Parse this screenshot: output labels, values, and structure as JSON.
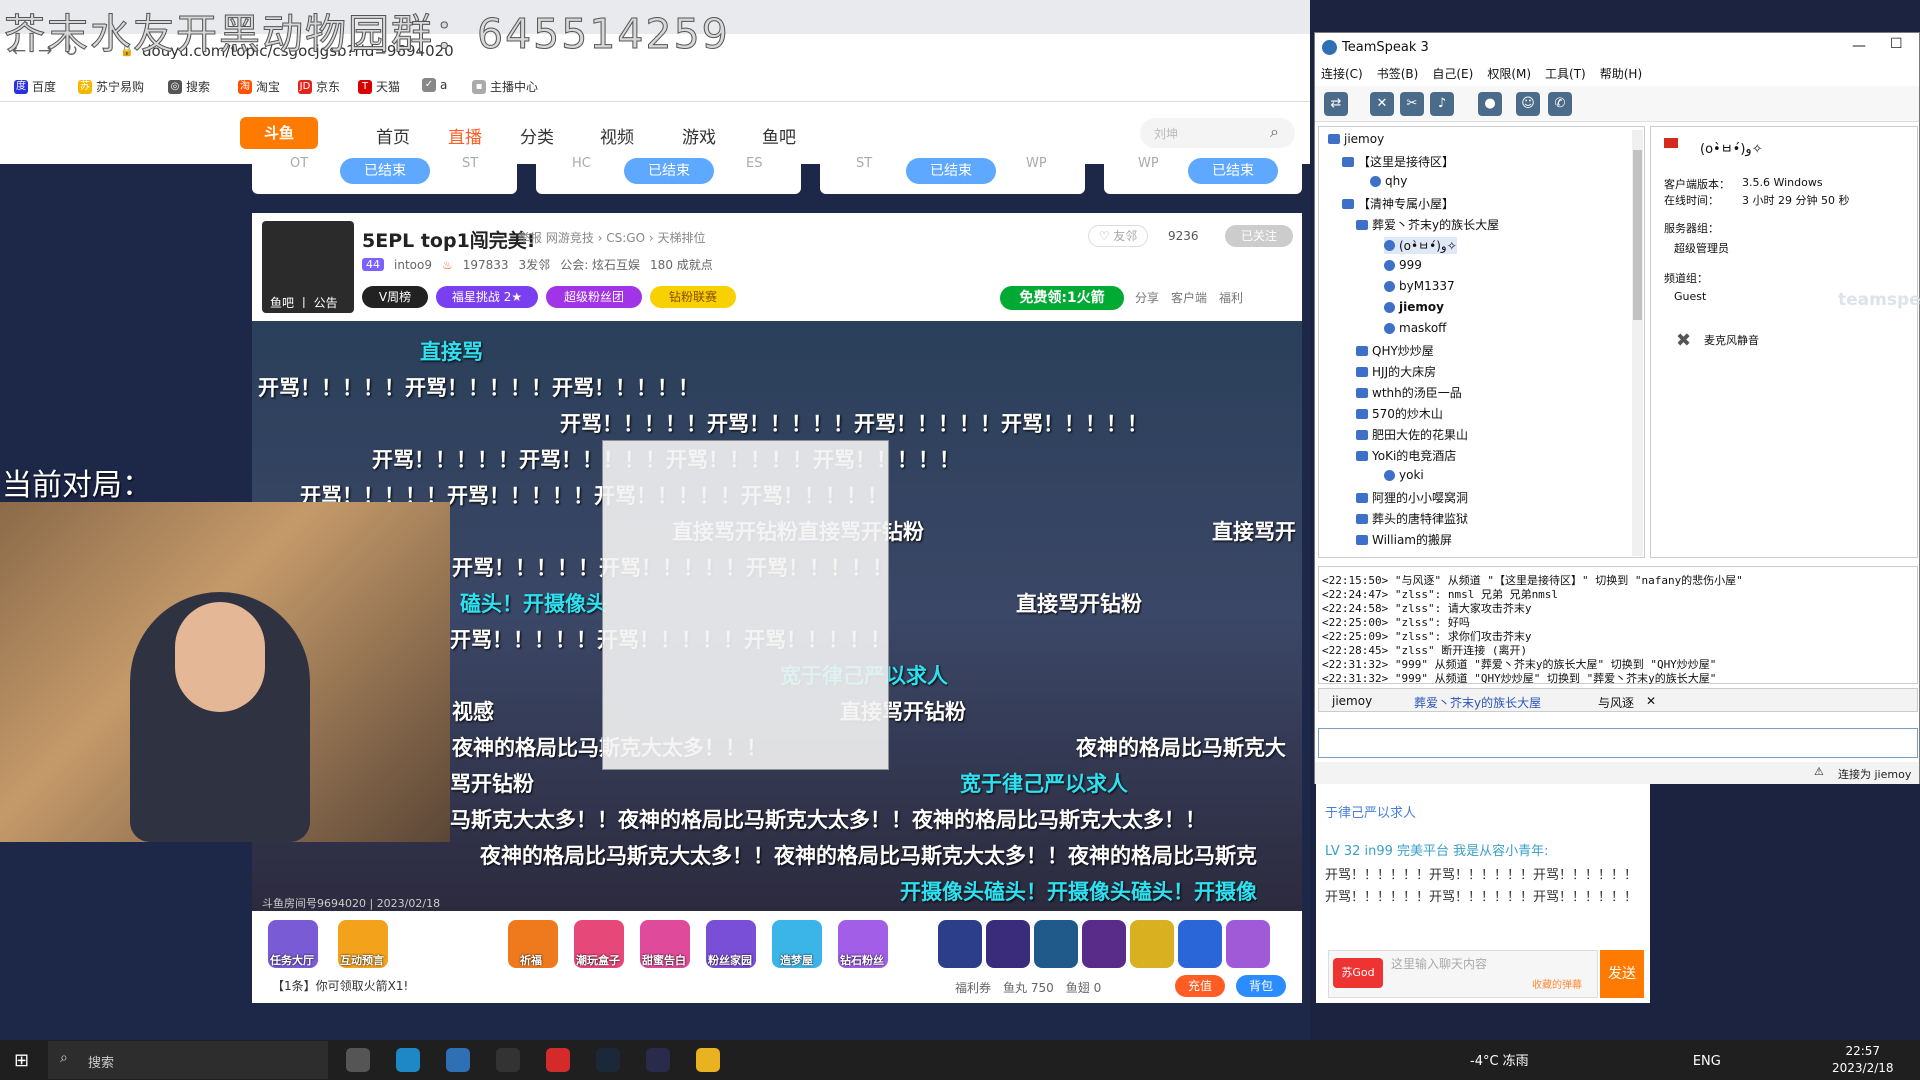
{
  "overlay_text": "芥末水友开黑动物园群：645514259",
  "browser": {
    "url": "douyu.com/topic/csgocjgsb?rid=9694020",
    "bookmarks": [
      "百度",
      "苏宁易购",
      "搜索",
      "淘宝",
      "京东",
      "天猫",
      "a",
      "主播中心"
    ]
  },
  "site": {
    "logo": "斗鱼",
    "nav": [
      "首页",
      "直播",
      "分类",
      "视频",
      "游戏",
      "鱼吧"
    ],
    "search_placeholder": "刘坤",
    "match_cards": [
      {
        "left": "OT",
        "right": "ST",
        "state": "已结束"
      },
      {
        "left": "HC",
        "right": "ES",
        "state": "已结束"
      },
      {
        "left": "ST",
        "right": "WP",
        "state": "已结束"
      },
      {
        "left": "WP",
        "right": "",
        "state": "已结束"
      }
    ]
  },
  "room": {
    "title": "5EPL top1闯完美!",
    "category": "举报   网游竞技 › CS:GO › 天梯排位",
    "level": "44",
    "anchor": "intoo9",
    "hot": "197833",
    "fans": "3发邻",
    "notice": "公会: 炫石互娱",
    "achievement": "180 成就点",
    "pic_label": "鱼吧 丨 公告",
    "tags": [
      "V周榜",
      "福星挑战 2★",
      "超级粉丝团",
      "钻粉联赛"
    ],
    "follow_label": "♡ 友邻",
    "follow_count": "9236",
    "follow_state": "已关注",
    "free_label": "免费领:1火箭",
    "actions": [
      "分享",
      "客户端",
      "福利"
    ]
  },
  "video": {
    "current_game": "当前对局：",
    "danmaku": [
      {
        "text": "直接骂",
        "c": true
      },
      {
        "text": "开骂！！！！！开骂！！！！！开骂！！！！！",
        "c": false
      },
      {
        "text": "开骂！！！！！开骂！！！！！开骂！！！！！开骂！！！！！",
        "c": false
      },
      {
        "text": "开骂！！！！！开骂！！！！！开骂！！！！！开骂！！！！！",
        "c": false
      },
      {
        "text": "开骂！！！！！开骂！！！！！开骂！！！！！开骂！！！！！",
        "c": false
      },
      {
        "text": "直接骂开钻粉直接骂开钻粉",
        "c": false
      },
      {
        "text": "开骂！！！！！开骂！！！！！开骂！！！！！",
        "c": false
      },
      {
        "text": "直接骂开钻粉",
        "c": false
      },
      {
        "text": "开骂！！！！！开骂！！！！！开骂！！！！！",
        "c": false
      },
      {
        "text": "宽于律己严以求人",
        "c": true
      },
      {
        "text": "夜神的格局比马斯克大太多！！！",
        "c": false
      },
      {
        "text": "马斯克大太多！！夜神的格局比马斯克大太多！！夜神的格局比马斯克大太多！！",
        "c": false
      },
      {
        "text": "夜神的格局比马斯克大太多！！夜神的格局比马斯克大太多！！夜神的格局比马斯克",
        "c": false
      },
      {
        "text": "开摄像头磕头！开摄像头磕头！开摄像",
        "c": true
      },
      {
        "text": "直接骂开钻粉",
        "c": false
      },
      {
        "text": "视感",
        "c": false
      },
      {
        "text": "骂开钻粉",
        "c": false
      },
      {
        "text": "磕头！开摄像头",
        "c": true
      },
      {
        "text": "夜神的格局比马斯克大",
        "c": false
      },
      {
        "text": "宽于律己严以求人",
        "c": true
      },
      {
        "text": "直接骂开",
        "c": false
      }
    ],
    "footer": "斗鱼房间号9694020 | 2023/02/18",
    "date": "2023/2/18"
  },
  "giftbar": {
    "gifts": [
      "任务大厅",
      "互动预言",
      "祈福",
      "潮玩盒子",
      "甜蜜告白",
      "粉丝家园",
      "造梦屋",
      "钻石粉丝"
    ],
    "claim_tip": "【1条】你可领取火箭X1!",
    "wallet": [
      "福利券",
      "鱼丸 750",
      "鱼翅 0"
    ],
    "recharge": "充值",
    "pack": "背包"
  },
  "site_chat": {
    "lines": [
      "于律己严以求人",
      "LV 32  in99  完美平台  我是从容小青年:",
      "开骂！！！！！！开骂！！！！！！开骂！！！！！！",
      "开骂！！！！！！开骂！！！！！！开骂！！！！！！"
    ],
    "input_placeholder": "这里输入聊天内容",
    "send": "发送",
    "badge": "苏God",
    "hint": "收藏的弹幕"
  },
  "teamspeak": {
    "title": "TeamSpeak 3",
    "menu": [
      "连接(C)",
      "书签(B)",
      "自己(E)",
      "权限(M)",
      "工具(T)",
      "帮助(H)"
    ],
    "tree": [
      {
        "label": "jiemoy",
        "kind": "server"
      },
      {
        "label": "【这里是接待区】",
        "kind": "channel"
      },
      {
        "label": "qhy",
        "kind": "user"
      },
      {
        "label": "【清神专属小屋】",
        "kind": "channel"
      },
      {
        "label": "葬爱丶芥末y的族长大屋",
        "kind": "channel"
      },
      {
        "label": "(o•̀ㅂ•́)و✧",
        "kind": "user"
      },
      {
        "label": "999",
        "kind": "user"
      },
      {
        "label": "byM1337",
        "kind": "user"
      },
      {
        "label": "jiemoy",
        "kind": "user"
      },
      {
        "label": "maskoff",
        "kind": "user"
      },
      {
        "label": "QHY炒炒屋",
        "kind": "channel"
      },
      {
        "label": "HJJ的大床房",
        "kind": "channel"
      },
      {
        "label": "wthh的汤臣一品",
        "kind": "channel"
      },
      {
        "label": "570的炒木山",
        "kind": "channel"
      },
      {
        "label": "肥田大佐的花果山",
        "kind": "channel"
      },
      {
        "label": "YoKi的电竞酒店",
        "kind": "channel"
      },
      {
        "label": "yoki",
        "kind": "user"
      },
      {
        "label": "阿狸的小小嘤窝洞",
        "kind": "channel"
      },
      {
        "label": "葬头的唐特律监狱",
        "kind": "channel"
      },
      {
        "label": "William的搬屏",
        "kind": "channel"
      }
    ],
    "info": {
      "nick": "(o•̀ㅂ•́)و✧",
      "version_label": "客户端版本：",
      "version": "3.5.6 Windows",
      "online_label": "在线时间：",
      "online": "3 小时 29 分钟 50 秒",
      "server_group_label": "服务器组：",
      "server_group": "超级管理员",
      "channel_group_label": "频道组：",
      "channel_group": "Guest",
      "mic": "麦克风静音",
      "watermark": "teamspeak"
    },
    "log": [
      "<22:15:50> \"与风逐\" 从频道 \"【这里是接待区】\" 切换到 \"nafany的悲伤小屋\"",
      "<22:24:47> \"zlss\": nmsl 兄弟 兄弟nmsl",
      "<22:24:58> \"zlss\": 请大家攻击芥末y",
      "<22:25:00> \"zlss\": 好吗",
      "<22:25:09> \"zlss\": 求你们攻击芥末y",
      "<22:28:45> \"zlss\" 断开连接 (离开)",
      "<22:31:32> \"999\" 从频道 \"葬爱丶芥末y的族长大屋\" 切换到 \"QHY炒炒屋\"",
      "<22:31:32> \"999\" 从频道 \"QHY炒炒屋\" 切换到 \"葬爱丶芥末y的族长大屋\""
    ],
    "tabs": [
      "jiemoy",
      "葬爱丶芥末y的族长大屋",
      "与风逐"
    ],
    "status": "连接为 jiemoy"
  },
  "taskbar": {
    "search": "搜索",
    "weather": "-4°C 冻雨",
    "lang": "ENG",
    "time": "22:57",
    "date": "2023/2/18"
  }
}
